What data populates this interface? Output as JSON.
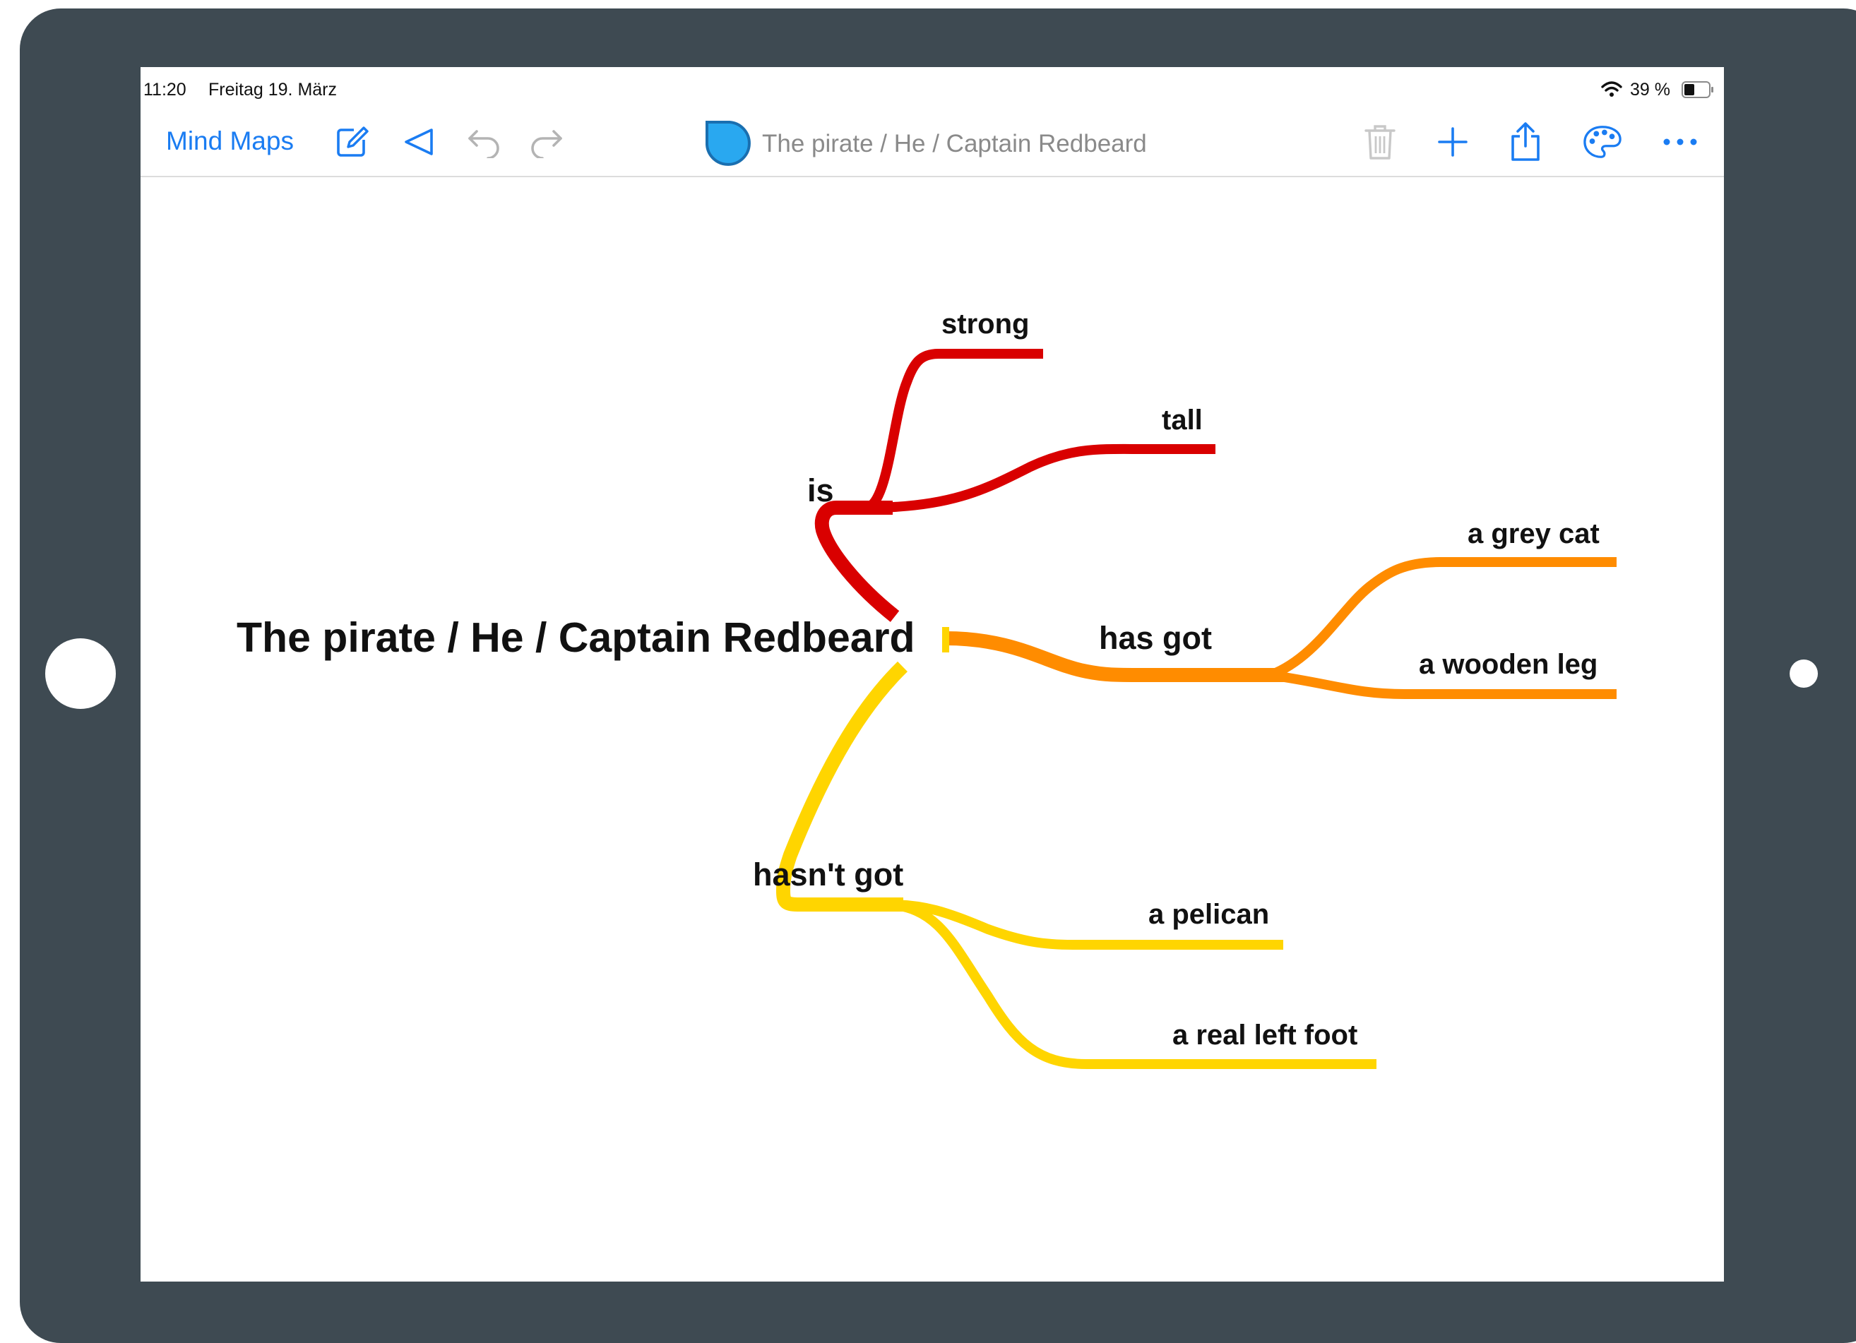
{
  "status_bar": {
    "time": "11:20",
    "date": "Freitag 19. März",
    "battery": "39 %"
  },
  "toolbar": {
    "back_label": "Mind Maps",
    "title": "The pirate / He / Captain Redbeard"
  },
  "mind_map": {
    "root": "The pirate / He / Captain Redbeard",
    "branches": [
      {
        "label": "is",
        "color": "#d90000",
        "children": [
          "strong",
          "tall"
        ]
      },
      {
        "label": "has got",
        "color": "#ff8c00",
        "children": [
          "a grey cat",
          "a wooden leg"
        ]
      },
      {
        "label": "hasn't got",
        "color": "#ffd500",
        "children": [
          "a pelican",
          "a real left foot"
        ]
      }
    ]
  },
  "colors": {
    "accent": "#1a7cf2",
    "frame": "#3e4a52",
    "doc_icon": "#29a8f0"
  },
  "icons": [
    "edit-icon",
    "back-triangle-icon",
    "undo-icon",
    "redo-icon",
    "map-doc-icon",
    "trash-icon",
    "add-icon",
    "share-icon",
    "palette-icon",
    "more-icon",
    "wifi-icon",
    "battery-icon"
  ]
}
